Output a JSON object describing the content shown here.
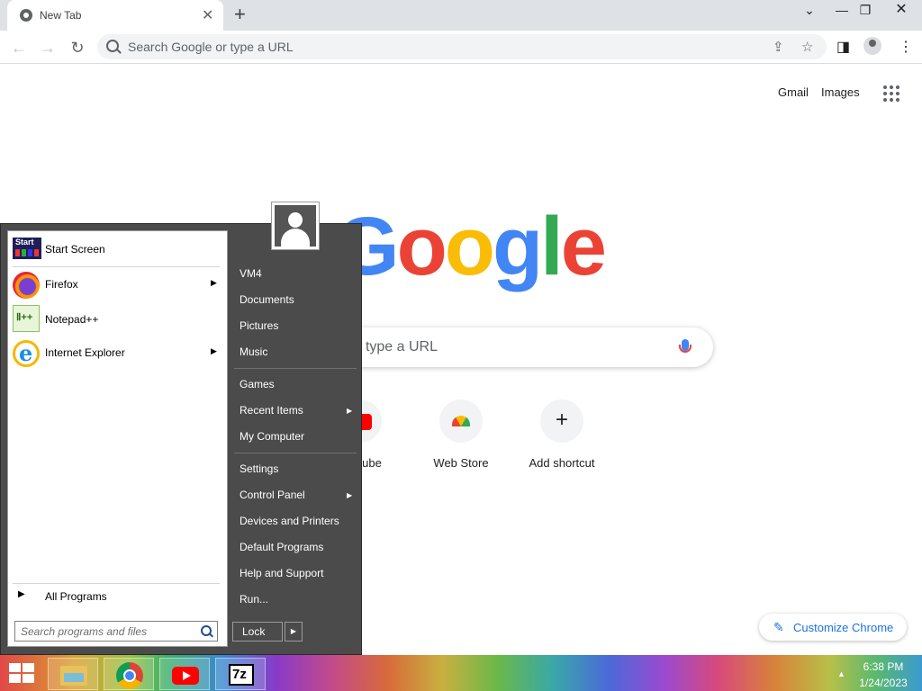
{
  "browser": {
    "tab_title": "New Tab",
    "tab_close": "✕",
    "new_tab": "+",
    "win_minimize": "⌄",
    "win_min": "—",
    "win_restore": "❐",
    "win_close": "✕",
    "back": "←",
    "forward": "→",
    "reload": "↻",
    "omnibox_placeholder": "Search Google or type a URL",
    "share_icon": "⇪",
    "bookmark_icon": "☆",
    "sidepanel_icon": "◨",
    "menu_icon": "⋮"
  },
  "ntp": {
    "gmail": "Gmail",
    "images": "Images",
    "logo_letters": [
      "G",
      "o",
      "o",
      "g",
      "l",
      "e"
    ],
    "logo_colors": [
      "#4285f4",
      "#ea4335",
      "#fbbc05",
      "#4285f4",
      "#34a853",
      "#ea4335"
    ],
    "search_placeholder": "Search Google or type a URL",
    "search_visible": "r type a URL",
    "shortcuts": [
      {
        "label": "ube",
        "full": "YouTube",
        "icon": "youtube-icon"
      },
      {
        "label": "Web Store",
        "icon": "web-store-icon"
      },
      {
        "label": "Add shortcut",
        "icon": "plus-icon"
      }
    ],
    "customize": "Customize Chrome",
    "customize_icon": "✎"
  },
  "start_menu": {
    "pinned": [
      {
        "label": "Start Screen",
        "icon": "start-screen-icon",
        "has_submenu": false
      },
      {
        "label": "Firefox",
        "icon": "firefox-icon",
        "has_submenu": true
      },
      {
        "label": "Notepad++",
        "icon": "notepadpp-icon",
        "has_submenu": false
      },
      {
        "label": "Internet Explorer",
        "icon": "internet-explorer-icon",
        "has_submenu": true
      }
    ],
    "start_tile_text": "Start",
    "npp_glyph": "Ⅱ++",
    "ie_glyph": "e",
    "all_programs": "All Programs",
    "search_placeholder": "Search programs and files",
    "right_items": [
      {
        "label": "VM4",
        "has_submenu": false
      },
      {
        "label": "Documents",
        "has_submenu": false
      },
      {
        "label": "Pictures",
        "has_submenu": false
      },
      {
        "label": "Music",
        "has_submenu": false
      },
      {
        "label": "Games",
        "has_submenu": false
      },
      {
        "label": "Recent Items",
        "has_submenu": true
      },
      {
        "label": "My Computer",
        "has_submenu": false
      },
      {
        "label": "Settings",
        "has_submenu": false
      },
      {
        "label": "Control Panel",
        "has_submenu": true
      },
      {
        "label": "Devices and Printers",
        "has_submenu": false
      },
      {
        "label": "Default Programs",
        "has_submenu": false
      },
      {
        "label": "Help and Support",
        "has_submenu": false
      },
      {
        "label": "Run...",
        "has_submenu": false
      }
    ],
    "lock": "Lock",
    "submenu_arrow": "▶"
  },
  "taskbar": {
    "pinned": [
      "file-explorer-icon",
      "chrome-icon",
      "youtube-icon",
      "7zip-icon"
    ],
    "seven_zip_text": "7z",
    "tray_arrow": "▲",
    "time": "6:38 PM",
    "date": "1/24/2023"
  }
}
